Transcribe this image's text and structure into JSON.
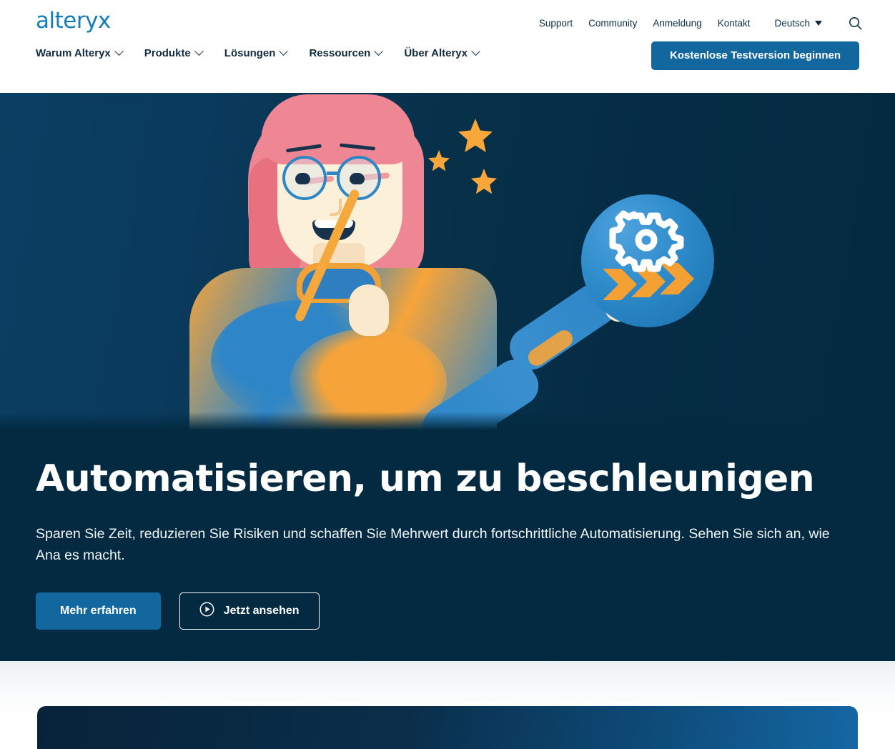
{
  "brand": {
    "logo_text": "alteryx",
    "logo_color": "#137cbd"
  },
  "header": {
    "utility_nav": [
      {
        "label": "Support"
      },
      {
        "label": "Community"
      },
      {
        "label": "Anmeldung"
      },
      {
        "label": "Kontakt"
      }
    ],
    "language": {
      "label": "Deutsch",
      "icon": "chevron-down-icon"
    },
    "search": {
      "icon": "search-icon"
    },
    "main_nav": [
      {
        "label": "Warum Alteryx",
        "icon": "chevron-down-icon"
      },
      {
        "label": "Produkte",
        "icon": "chevron-down-icon"
      },
      {
        "label": "Lösungen",
        "icon": "chevron-down-icon"
      },
      {
        "label": "Ressourcen",
        "icon": "chevron-down-icon"
      },
      {
        "label": "Über Alteryx",
        "icon": "chevron-down-icon"
      }
    ],
    "cta": {
      "label": "Kostenlose Testversion beginnen",
      "bg": "#11679e"
    }
  },
  "hero": {
    "title": "Automatisieren, um zu beschleunigen",
    "subtitle": "Sparen Sie Zeit, reduzieren Sie Risiken und schaffen Sie Mehrwert durch fortschrittliche Automatisierung. Sehen Sie sich an, wie Ana es macht.",
    "primary_button": {
      "label": "Mehr erfahren",
      "bg": "#11679e"
    },
    "secondary_button": {
      "label": "Jetzt ansehen",
      "icon": "play-circle-icon"
    },
    "background_color": "#032a41",
    "illustration": {
      "alt_name": "woman-with-magic-wand-illustration",
      "hair_color": "#ef8694",
      "sweater_colors": [
        "#2e86c8",
        "#f6a43a"
      ],
      "star_color": "#f9a63a",
      "badge": {
        "name": "gear-chevrons-badge",
        "circle_color": "#2f8ccb",
        "gear_color": "#ffffff",
        "chevron_color": "#f5a033"
      }
    }
  },
  "next_section": {
    "name": "next-content-card"
  }
}
